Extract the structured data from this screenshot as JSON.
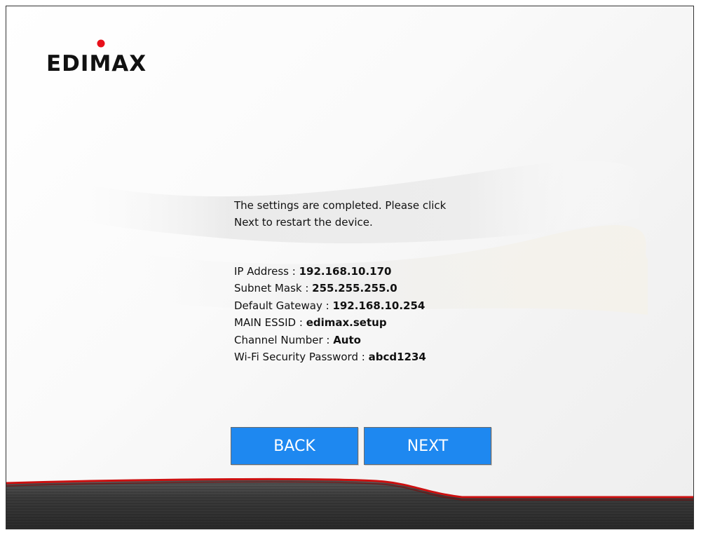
{
  "brand": {
    "logo_text": "EDIMAX",
    "logo_color": "#111111",
    "dot_color": "#e8101a"
  },
  "message": {
    "line1": "The settings are completed. Please click",
    "line2": "Next to restart the device."
  },
  "settings": [
    {
      "label": "IP Address : ",
      "value": "192.168.10.170"
    },
    {
      "label": "Subnet Mask : ",
      "value": "255.255.255.0"
    },
    {
      "label": "Default Gateway : ",
      "value": "192.168.10.254"
    },
    {
      "label": "MAIN ESSID : ",
      "value": "edimax.setup"
    },
    {
      "label": "Channel Number : ",
      "value": "Auto"
    },
    {
      "label": "Wi-Fi Security Password : ",
      "value": "abcd1234"
    }
  ],
  "buttons": {
    "back_label": "BACK",
    "next_label": "NEXT",
    "color": "#1e88f0"
  },
  "footer": {
    "accent_color": "#cc1111",
    "band_color": "#3a3a3a"
  }
}
